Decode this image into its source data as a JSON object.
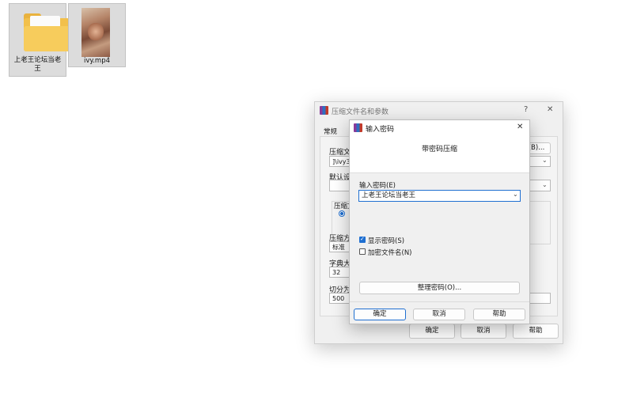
{
  "desktop": {
    "folder_label_line1": "上老王论坛当老",
    "folder_label_line2": "王",
    "video_label": "ivy.mp4"
  },
  "back_dialog": {
    "title": "压缩文件名和参数",
    "help_glyph": "?",
    "close_glyph": "✕",
    "tab_general": "常规",
    "archive_name_label": "压缩文",
    "archive_name_value": "]\\ivy3",
    "browse_button": "(B)...",
    "default_settings_label": "默认设",
    "format_group_label": "压缩文",
    "compression_method_label": "压缩方",
    "compression_method_value": "标准",
    "dictionary_label": "字典大",
    "dictionary_value": "32",
    "split_label": "切分为",
    "split_value": "500",
    "ok_button": "确定",
    "cancel_button": "取消",
    "help_button": "帮助"
  },
  "password_dialog": {
    "title": "输入密码",
    "close_glyph": "✕",
    "heading": "带密码压缩",
    "password_label": "输入密码(E)",
    "password_value": "上老王论坛当老王",
    "show_password_label": "显示密码(S)",
    "show_password_checked": true,
    "encrypt_names_label": "加密文件名(N)",
    "encrypt_names_checked": false,
    "organize_button": "整理密码(O)...",
    "ok_button": "确定",
    "cancel_button": "取消",
    "help_button": "帮助"
  }
}
